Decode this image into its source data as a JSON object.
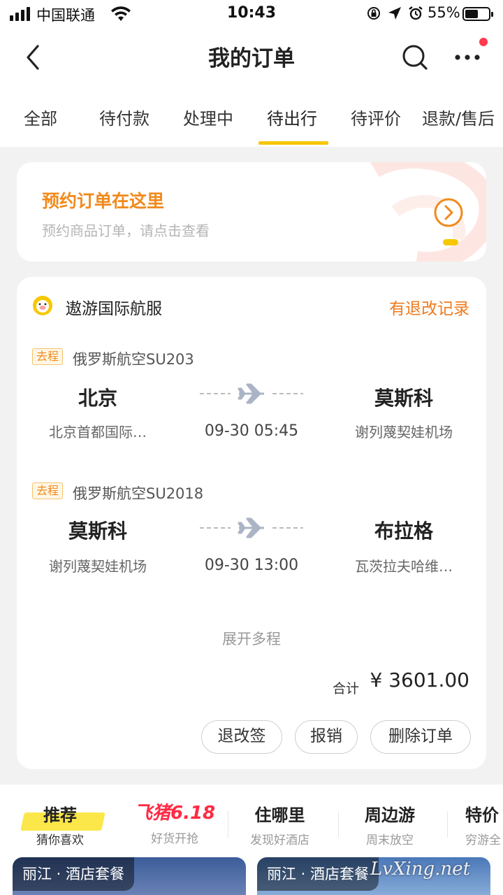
{
  "status_bar": {
    "carrier": "中国联通",
    "time": "10:43",
    "battery": "55%",
    "battery_level": 0.55
  },
  "navbar": {
    "title": "我的订单"
  },
  "tabs": [
    {
      "label": "全部"
    },
    {
      "label": "待付款"
    },
    {
      "label": "处理中"
    },
    {
      "label": "待出行",
      "active": true
    },
    {
      "label": "待评价"
    },
    {
      "label": "退款/售后"
    }
  ],
  "promo": {
    "title": "预约订单在这里",
    "subtitle": "预约商品订单，请点击查看"
  },
  "order": {
    "shop": "遨游国际航服",
    "record": "有退改记录",
    "segments": [
      {
        "badge": "去程",
        "airline": "俄罗斯航空SU203",
        "from_city": "北京",
        "from_airport": "北京首都国际…",
        "time": "09-30 05:45",
        "to_city": "莫斯科",
        "to_airport": "谢列蔑契娃机场"
      },
      {
        "badge": "去程",
        "airline": "俄罗斯航空SU2018",
        "from_city": "莫斯科",
        "from_airport": "谢列蔑契娃机场",
        "time": "09-30 13:00",
        "to_city": "布拉格",
        "to_airport": "瓦茨拉夫哈维…"
      }
    ],
    "expand": "展开多程",
    "total_label": "合计",
    "total_value": "¥ 3601.00",
    "buttons": {
      "change": "退改签",
      "reimburse": "报销",
      "delete": "删除订单"
    }
  },
  "recommend": {
    "tabs": [
      {
        "main": "推荐",
        "sub": "猜你喜欢"
      },
      {
        "main": "飞猪6.18",
        "sub": "好货开抢"
      },
      {
        "main": "住哪里",
        "sub": "发现好酒店"
      },
      {
        "main": "周边游",
        "sub": "周末放空"
      },
      {
        "main": "特价",
        "sub": "穷游全"
      }
    ],
    "cards": [
      {
        "tag": "丽江 · 酒店套餐"
      },
      {
        "tag": "丽江 · 酒店套餐"
      }
    ],
    "watermark": "LvXing.net"
  },
  "colors": {
    "accent_yellow": "#f7c700",
    "orange": "#f08a1c",
    "red_dot": "#ff3b4d",
    "background": "#f2f2f2"
  },
  "icons": [
    "signal-icon",
    "wifi-icon",
    "lock-rotation-icon",
    "location-icon",
    "alarm-icon",
    "battery-icon",
    "back-arrow-icon",
    "search-icon",
    "more-icon",
    "chevron-right-circle-icon",
    "fliggy-logo-icon",
    "plane-icon"
  ]
}
